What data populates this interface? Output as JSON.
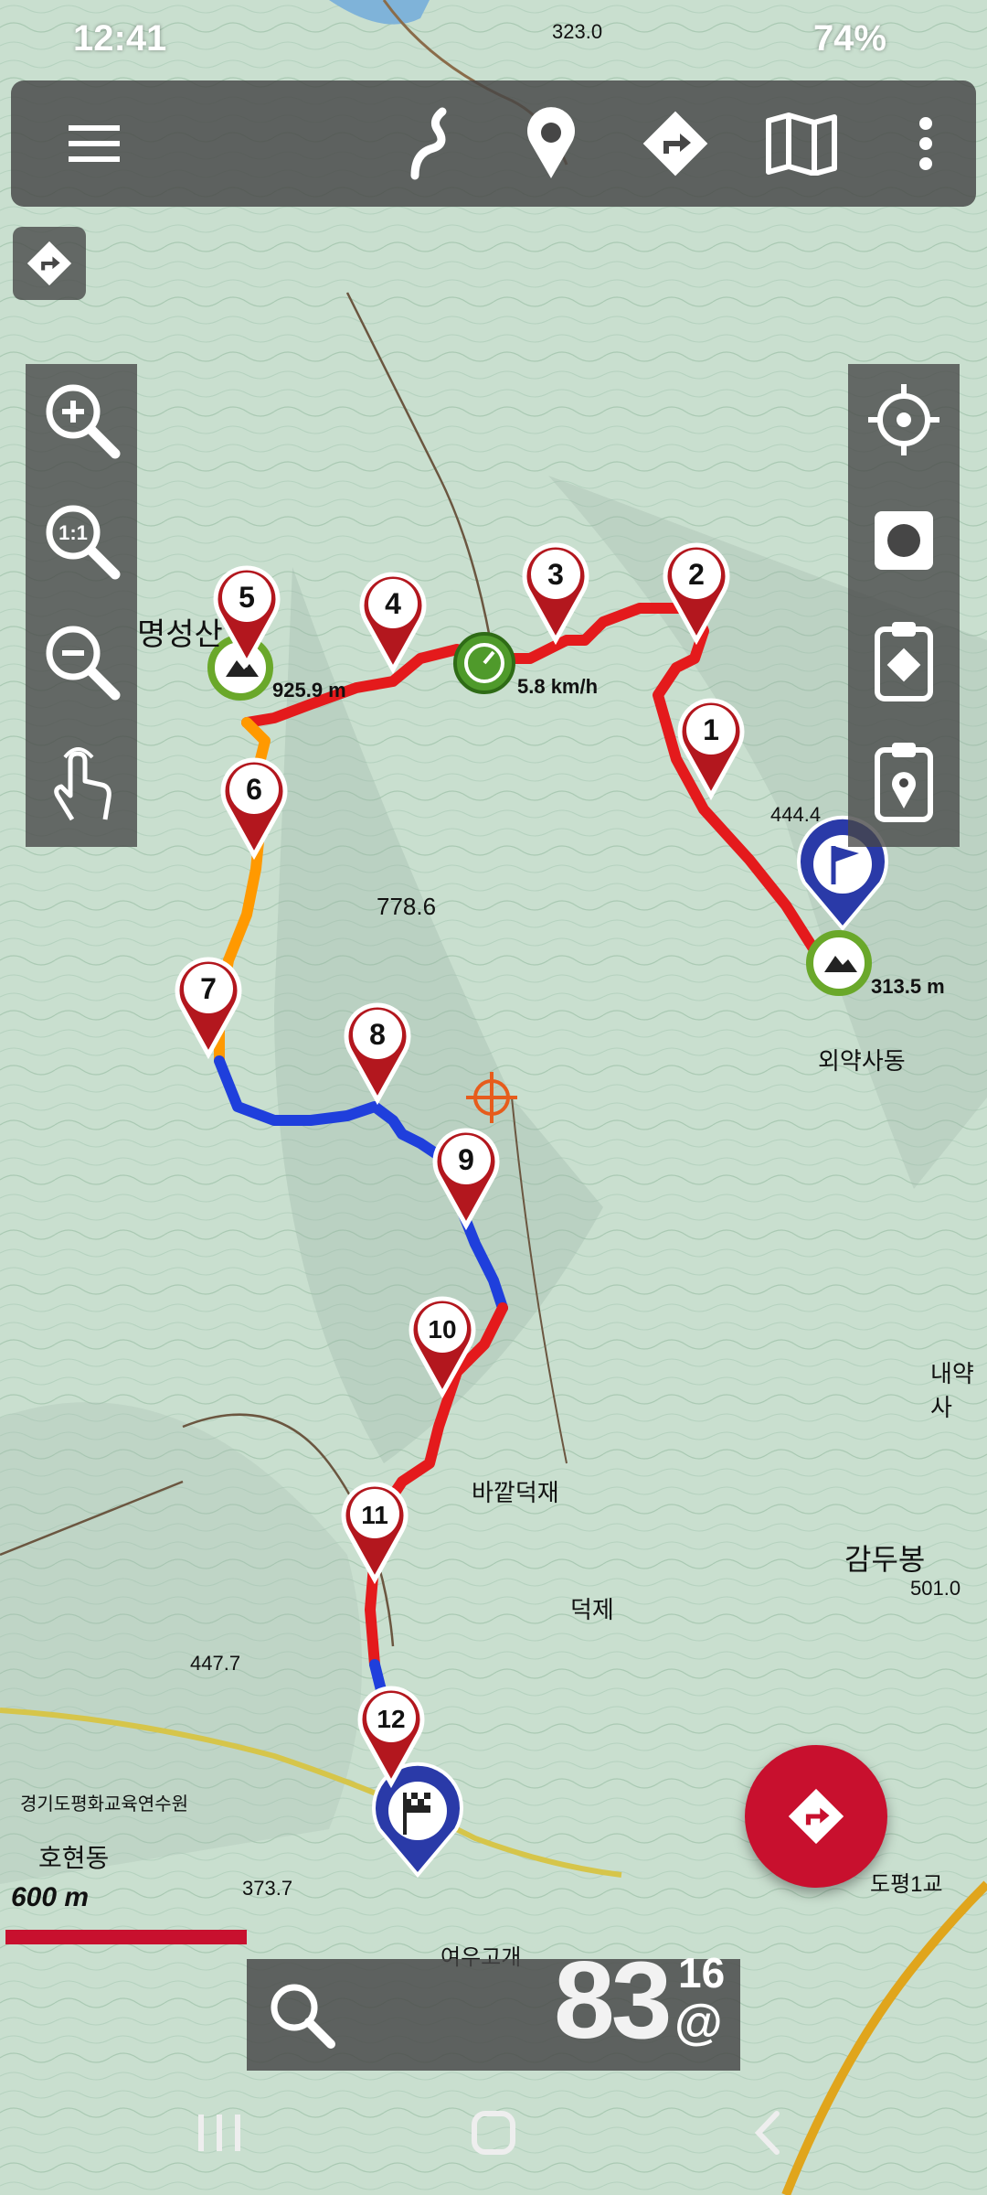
{
  "status_bar": {
    "time": "12:41",
    "battery": "74%"
  },
  "toolbar": {
    "buttons": [
      "menu",
      "track",
      "waypoint",
      "route",
      "map",
      "more"
    ]
  },
  "route": {
    "waypoints": [
      "1",
      "2",
      "3",
      "4",
      "5",
      "6",
      "7",
      "8",
      "9",
      "10",
      "11",
      "12"
    ]
  },
  "readouts": {
    "speed": "5.8 km/h",
    "start_elevation": "313.5 m",
    "summit_elevation": "925.9 m"
  },
  "map_labels": {
    "peak_778": "778.6",
    "peak_444": "444.4",
    "peak_447": "447.7",
    "peak_373": "373.7",
    "peak_501": "501.0",
    "peak_323": "323.0",
    "oeyak": "외약사동",
    "gamdubong": "감두봉",
    "bakkat": "바깥덕재",
    "deokje": "덕제",
    "hohyeon": "호현동",
    "yeouugogae": "여우고개",
    "dopyeong": "도평1교",
    "naeyak": "내약사",
    "gyeonggi": "경기도평화교육연수원",
    "mountain": "명성산"
  },
  "scale": {
    "label": "600 m"
  },
  "zoom": {
    "level": "83",
    "sub": "16",
    "suffix": "@"
  },
  "colors": {
    "accent": "#c8102e",
    "panel": "#464646",
    "route_fast": "#e41a1c",
    "route_slow": "#1f3fdc"
  }
}
